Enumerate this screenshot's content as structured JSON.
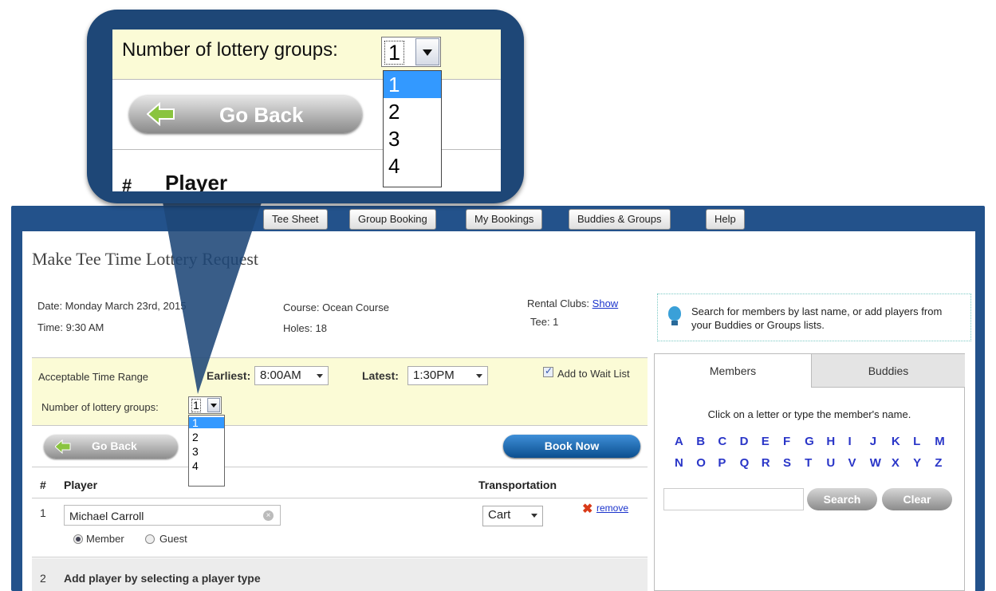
{
  "nav": {
    "tee_sheet": "Tee Sheet",
    "group_booking": "Group Booking",
    "my_bookings": "My Bookings",
    "buddies_groups": "Buddies & Groups",
    "help": "Help"
  },
  "page_title": "Make Tee Time Lottery Request",
  "info": {
    "date": "Date:  Monday March 23rd, 2015",
    "time": "Time:  9:30 AM",
    "course": "Course:  Ocean Course",
    "holes": "Holes:  18",
    "rental_label": "Rental Clubs:",
    "rental_link": "Show",
    "tee": "Tee:  1"
  },
  "help_text": "Search for members by last name, or add players from your Buddies or Groups lists.",
  "lottery": {
    "range_label": "Acceptable Time Range",
    "earliest_label": "Earliest:",
    "earliest_value": "8:00AM",
    "latest_label": "Latest:",
    "latest_value": "1:30PM",
    "wait_list_label": "Add to Wait List",
    "wait_list_checked": true,
    "groups_label": "Number of lottery groups:",
    "groups_value": "1",
    "groups_options": [
      "1",
      "2",
      "3",
      "4"
    ]
  },
  "buttons": {
    "go_back": "Go Back",
    "book_now": "Book Now",
    "search": "Search",
    "clear": "Clear"
  },
  "table": {
    "col_num": "#",
    "col_player": "Player",
    "col_transport": "Transportation",
    "rows": [
      {
        "num": "1",
        "player": "Michael Carroll",
        "transport": "Cart",
        "remove": "remove",
        "member_label": "Member",
        "guest_label": "Guest",
        "type_selected": "Member"
      },
      {
        "num": "2",
        "text": "Add player by selecting a player type"
      }
    ]
  },
  "right_panel": {
    "tabs": [
      "Members",
      "Buddies"
    ],
    "active_tab": "Members",
    "instruction": "Click on a letter or type the member's name.",
    "letters_row1": [
      "A",
      "B",
      "C",
      "D",
      "E",
      "F",
      "G",
      "H",
      "I",
      "J",
      "K",
      "L",
      "M"
    ],
    "letters_row2": [
      "N",
      "O",
      "P",
      "Q",
      "R",
      "S",
      "T",
      "U",
      "V",
      "W",
      "X",
      "Y",
      "Z"
    ],
    "search_value": ""
  },
  "callout": {
    "groups_label": "Number of lottery groups:",
    "groups_value": "1",
    "options": [
      "1",
      "2",
      "3",
      "4"
    ],
    "go_back": "Go Back",
    "col_num": "#",
    "col_player": "Player"
  },
  "colors": {
    "frame": "#23528b",
    "lottery_bg": "#fbfbd6",
    "letter_link": "#2a36c8",
    "book_now": "#1a6cb8",
    "dropdown_selected": "#3399ff"
  }
}
